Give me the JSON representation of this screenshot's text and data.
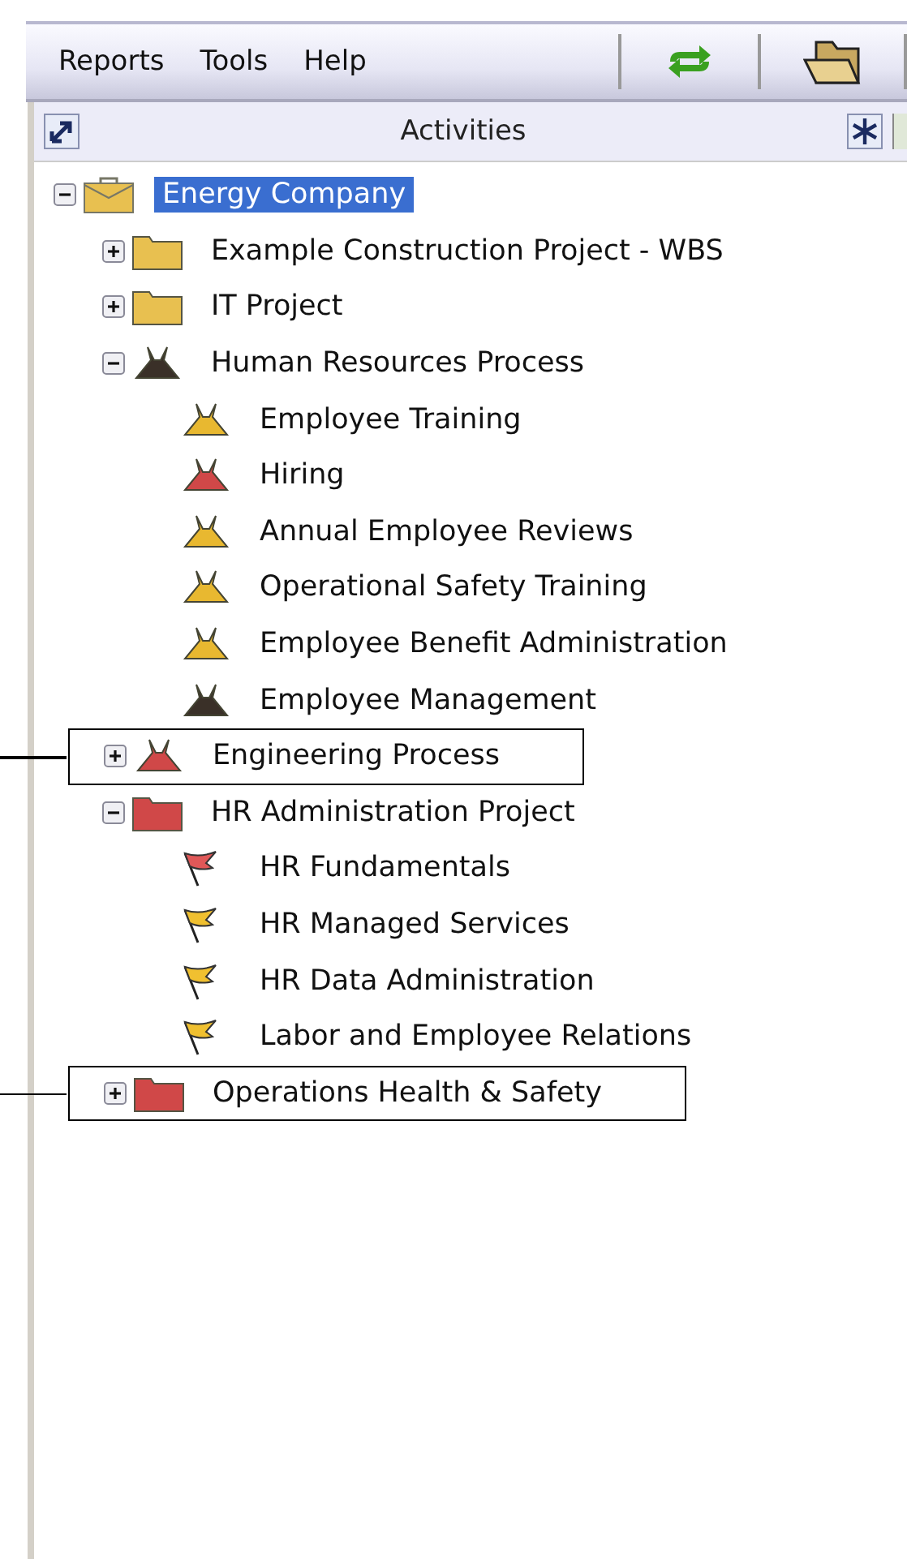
{
  "menu": [
    "Reports",
    "Tools",
    "Help"
  ],
  "panel": {
    "title": "Activities"
  },
  "tree": [
    {
      "label": "Energy Company",
      "kind": "briefcase",
      "color": "#e8c050",
      "expanded": true,
      "selected": true,
      "callout": false,
      "children": [
        {
          "label": "Example Construction Project - WBS",
          "kind": "folder",
          "color": "#e8c050",
          "expanded": false,
          "selected": false,
          "callout": false
        },
        {
          "label": "IT Project",
          "kind": "folder",
          "color": "#e8c050",
          "expanded": false,
          "selected": false,
          "callout": false
        },
        {
          "label": "Human Resources Process",
          "kind": "flask",
          "color": "#3a3028",
          "expanded": true,
          "selected": false,
          "callout": false,
          "children": [
            {
              "label": "Employee Training",
              "kind": "flask",
              "color": "#e8b830",
              "selected": false,
              "callout": false
            },
            {
              "label": "Hiring",
              "kind": "flask",
              "color": "#d04848",
              "selected": false,
              "callout": false
            },
            {
              "label": "Annual Employee Reviews",
              "kind": "flask",
              "color": "#e8b830",
              "selected": false,
              "callout": false
            },
            {
              "label": "Operational Safety Training",
              "kind": "flask",
              "color": "#e8b830",
              "selected": false,
              "callout": false
            },
            {
              "label": "Employee Benefit Administration",
              "kind": "flask",
              "color": "#e8b830",
              "selected": false,
              "callout": false
            },
            {
              "label": "Employee Management",
              "kind": "flask",
              "color": "#3a3028",
              "selected": false,
              "callout": false
            }
          ]
        },
        {
          "label": "Engineering Process",
          "kind": "flask",
          "color": "#d04848",
          "expanded": false,
          "selected": false,
          "callout": true
        },
        {
          "label": "HR Administration Project",
          "kind": "folder",
          "color": "#d04848",
          "expanded": true,
          "selected": false,
          "callout": false,
          "children": [
            {
              "label": "HR Fundamentals",
              "kind": "flag",
              "color": "#e05858",
              "selected": false,
              "callout": false
            },
            {
              "label": "HR Managed Services",
              "kind": "flag",
              "color": "#f0c030",
              "selected": false,
              "callout": false
            },
            {
              "label": "HR Data Administration",
              "kind": "flag",
              "color": "#f0c030",
              "selected": false,
              "callout": false
            },
            {
              "label": "Labor and Employee Relations",
              "kind": "flag",
              "color": "#f0c030",
              "selected": false,
              "callout": false
            }
          ]
        },
        {
          "label": "Operations Health & Safety",
          "kind": "folder",
          "color": "#d04848",
          "expanded": false,
          "selected": false,
          "callout": true
        }
      ]
    }
  ]
}
